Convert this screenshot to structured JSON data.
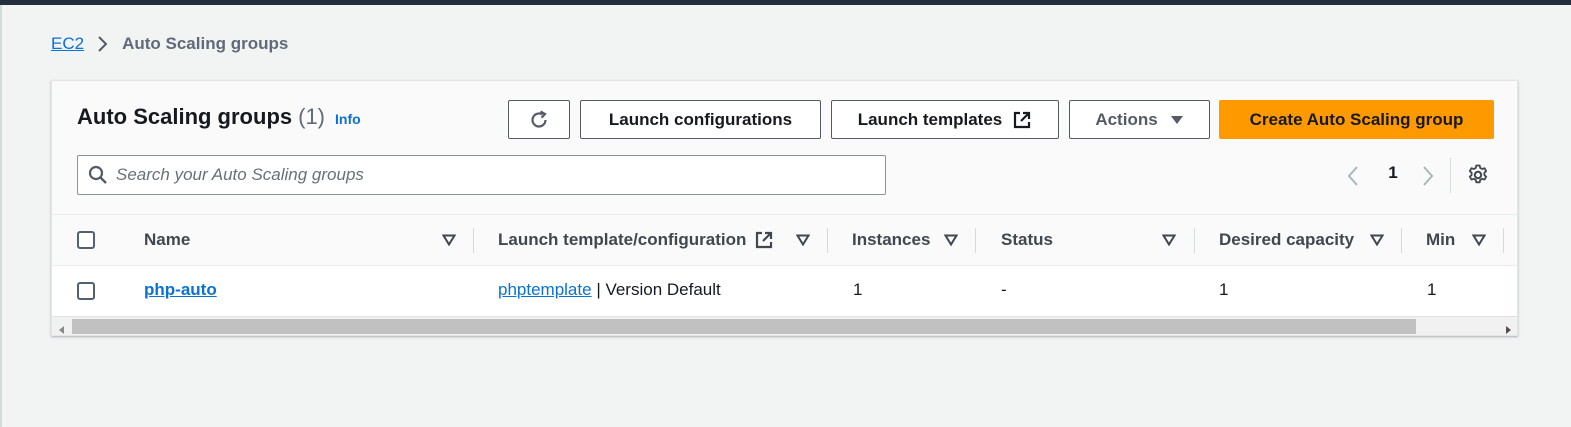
{
  "breadcrumb": {
    "root": "EC2",
    "current": "Auto Scaling groups"
  },
  "panel": {
    "title": "Auto Scaling groups",
    "count": "(1)",
    "info": "Info"
  },
  "toolbar": {
    "refresh_icon": "refresh-icon",
    "launch_configurations": "Launch configurations",
    "launch_templates": "Launch templates",
    "actions": "Actions",
    "create": "Create Auto Scaling group"
  },
  "search": {
    "placeholder": "Search your Auto Scaling groups",
    "value": ""
  },
  "pagination": {
    "current_page": "1"
  },
  "table": {
    "columns": [
      "Name",
      "Launch template/configuration",
      "Instances",
      "Status",
      "Desired capacity",
      "Min"
    ],
    "rows": [
      {
        "name": "php-auto",
        "launch_template_link": "phptemplate",
        "launch_template_version": "| Version Default",
        "instances": "1",
        "status": "-",
        "desired_capacity": "1",
        "min": "1"
      }
    ]
  },
  "colors": {
    "primary_button": "#ff9900",
    "link": "#0972d3",
    "top_bar": "#232f3e",
    "background": "#f2f3f3"
  }
}
